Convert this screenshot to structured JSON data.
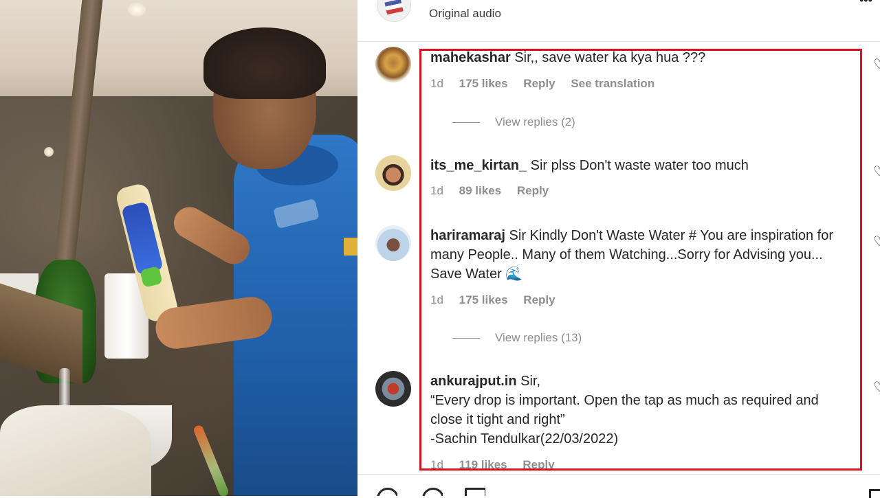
{
  "audio": {
    "label": "Original audio"
  },
  "comments": [
    {
      "username": "mahekashar",
      "text": "Sir,, save water ka kya hua ???",
      "time": "1d",
      "likes": "175 likes",
      "reply": "Reply",
      "translate": "See translation",
      "view_replies": "View replies (2)"
    },
    {
      "username": "its_me_kirtan_",
      "text": "Sir plss Don't waste water too much",
      "time": "1d",
      "likes": "89 likes",
      "reply": "Reply"
    },
    {
      "username": "hariramaraj",
      "text": "Sir Kindly Don't Waste Water # You are inspiration for many People.. Many of them Watching...Sorry for Advising you... Save Water 🌊",
      "time": "1d",
      "likes": "175 likes",
      "reply": "Reply",
      "view_replies": "View replies (13)"
    },
    {
      "username": "ankurajput.in",
      "text_line1": "Sir,",
      "text_line2": "“Every drop is important. Open the tap as much as required and close it tight and right”",
      "text_line3": "-Sachin Tendulkar(22/03/2022)",
      "time": "1d",
      "likes": "119 likes",
      "reply": "Reply"
    }
  ],
  "colors": {
    "highlight_border": "#d7131f",
    "muted_text": "#8e8e8e",
    "primary_text": "#262626"
  },
  "icons": [
    "more-icon",
    "heart-icon",
    "comment-icon",
    "share-icon",
    "bookmark-icon"
  ]
}
